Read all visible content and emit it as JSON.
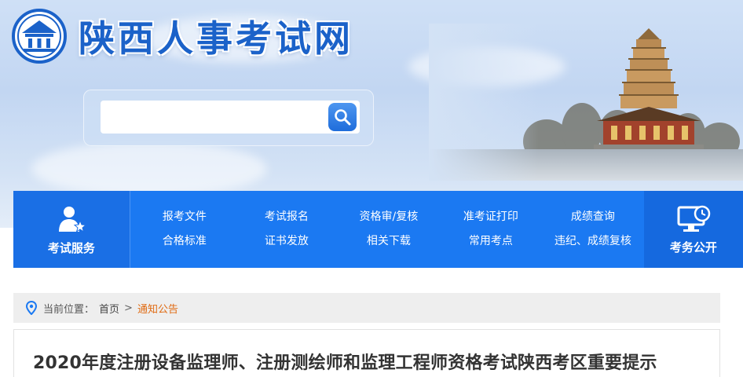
{
  "header": {
    "site_title": "陕西人事考试网",
    "search": {
      "placeholder": "",
      "button_icon": "search-icon"
    }
  },
  "nav": {
    "service": {
      "label": "考试服务",
      "icon": "user-star-icon"
    },
    "links": [
      "报考文件",
      "考试报名",
      "资格审/复核",
      "准考证打印",
      "成绩查询",
      "合格标准",
      "证书发放",
      "相关下载",
      "常用考点",
      "违纪、成绩复核"
    ],
    "public": {
      "label": "考务公开",
      "icon": "monitor-clock-icon"
    }
  },
  "breadcrumb": {
    "prefix": "当前位置：",
    "home": "首页",
    "separator": ">",
    "current": "通知公告",
    "icon": "location-pin-icon"
  },
  "article": {
    "title": "2020年度注册设备监理师、注册测绘师和监理工程师资格考试陕西考区重要提示"
  },
  "colors": {
    "brand_blue": "#1b79f2",
    "title_blue": "#1b62c9",
    "breadcrumb_current": "#e06b13"
  }
}
